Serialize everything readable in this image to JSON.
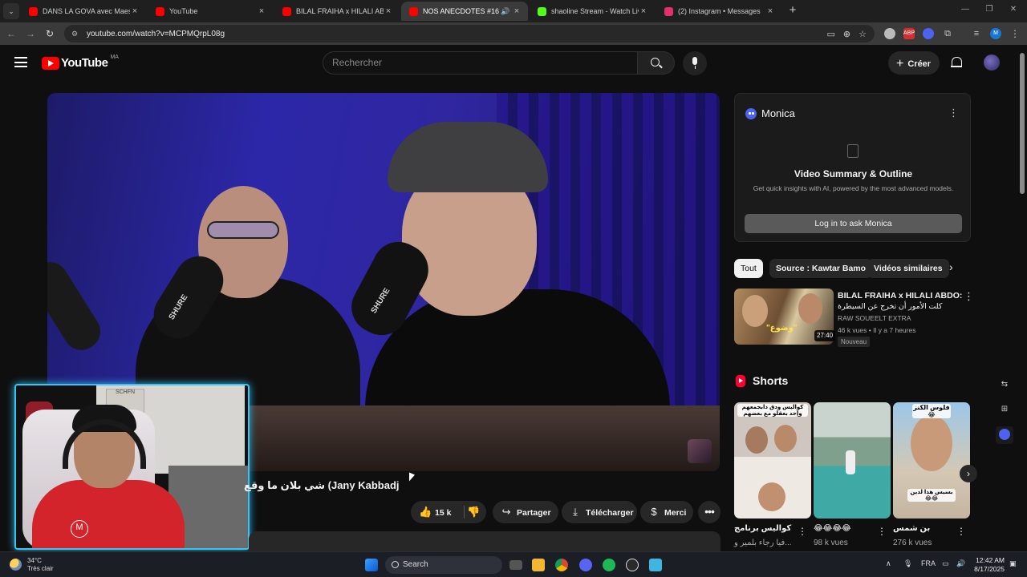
{
  "browser": {
    "tabs": [
      {
        "title": "DANS LA GOVA avec Maes | \"Le...",
        "favicon_color": "#ff0000"
      },
      {
        "title": "YouTube",
        "favicon_color": "#ff0000"
      },
      {
        "title": "BILAL FRAIHA x HILALI ABDO: ...",
        "favicon_color": "#ff0000"
      },
      {
        "title": "NOS ANECDOTES #16 (ft Fa...",
        "favicon_color": "#ff0000",
        "active": true
      },
      {
        "title": "shaoline Stream - Watch Live o...",
        "favicon_color": "#53fc18"
      },
      {
        "title": "(2) Instagram • Messages",
        "favicon_color": "#e1306c"
      }
    ],
    "url": "youtube.com/watch?v=MCPMQrpL08g",
    "new_tab_symbol": "+",
    "close_symbol": "×"
  },
  "youtube": {
    "logo_text": "YouTube",
    "country_code": "MA",
    "search_placeholder": "Rechercher",
    "create_label": "Créer",
    "create_plus": "+",
    "icons": {
      "menu": "hamburger-icon",
      "search": "search-icon",
      "mic": "microphone-icon",
      "notifications": "bell-icon"
    }
  },
  "video": {
    "title_visible": "شي بلان ما وقع (Jany Kabbadj",
    "like_count": "15 k",
    "actions": {
      "share": "Partager",
      "download": "Télécharger",
      "thanks": "Merci"
    },
    "overlay_text": [
      "SHURE",
      "SHURE"
    ]
  },
  "webcam": {
    "poster_text": "SCHFN"
  },
  "monica": {
    "name": "Monica",
    "title": "Video Summary & Outline",
    "subtitle": "Get quick insights with AI, powered by the most advanced models.",
    "button": "Log in to ask Monica",
    "brand_color": "#4d62f0"
  },
  "chips": [
    {
      "label": "Tout",
      "selected": true
    },
    {
      "label": "Source : Kawtar Bamo",
      "selected": false
    },
    {
      "label": "Vidéos similaires",
      "selected": false
    }
  ],
  "recommendation": {
    "title": "BILAL FRAIHA x HILALI ABDO:",
    "title_line2": "كلت الأمور أن تخرج عن السيطرة",
    "channel": "RAW SOUEELT EXTRA",
    "meta": "46 k vues • Il y a 7 heures",
    "badge": "Nouveau",
    "duration": "27:40",
    "thumb_caption": "\"وضوع\""
  },
  "shorts": {
    "heading": "Shorts",
    "items": [
      {
        "title": "كواليس برنامج",
        "views": "فيا رجاء بلمير و...",
        "overlay": "كواليس ودق دابجمعهم وإحد بعقلو مع بعضهم"
      },
      {
        "title": "😂😂😂😂",
        "views": "98 k vues",
        "overlay": ""
      },
      {
        "title": "بن شمس",
        "views": "276 k vues",
        "overlay": "فلوس الكنز 😂",
        "overlay2": "بسيس هذا لدين 😂😂"
      }
    ]
  },
  "taskbar": {
    "weather_temp": "34°C",
    "weather_desc": "Très clair",
    "search_label": "Search",
    "language": "FRA",
    "time": "12:42 AM",
    "date": "8/17/2025"
  }
}
